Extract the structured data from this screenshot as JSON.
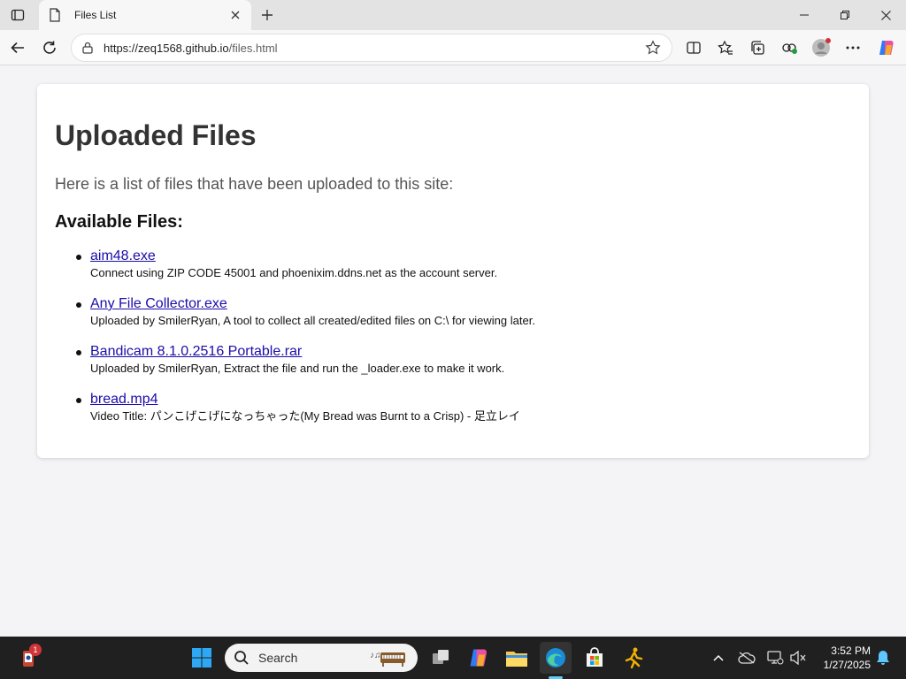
{
  "browser": {
    "tab_title": "Files List",
    "url_host": "https://zeq1568.github.io",
    "url_path": "/files.html",
    "icons": [
      "tab-actions-icon",
      "page-icon",
      "close-icon",
      "plus-icon",
      "minimize-icon",
      "restore-icon",
      "window-close-icon",
      "back-icon",
      "refresh-icon",
      "site-info-icon",
      "favorite-star-icon",
      "split-screen-icon",
      "favorites-icon",
      "collections-icon",
      "extensions-icon",
      "profile-icon",
      "more-icon",
      "copilot-icon"
    ]
  },
  "page": {
    "title": "Uploaded Files",
    "intro": "Here is a list of files that have been uploaded to this site:",
    "section_heading": "Available Files:",
    "files": [
      {
        "name": "aim48.exe",
        "desc": "Connect using ZIP CODE 45001 and phoenixim.ddns.net as the account server."
      },
      {
        "name": "Any File Collector.exe",
        "desc": "Uploaded by SmilerRyan, A tool to collect all created/edited files on C:\\ for viewing later."
      },
      {
        "name": "Bandicam 8.1.0.2516 Portable.rar",
        "desc": "Uploaded by SmilerRyan, Extract the file and run the _loader.exe to make it work."
      },
      {
        "name": "bread.mp4",
        "desc": "Video Title: パンこげこげになっちゃった(My Bread was Burnt to a Crisp) - 足立レイ"
      }
    ],
    "link_color": "#1a0dab"
  },
  "taskbar": {
    "search_placeholder": "Search",
    "notification_count": "1",
    "time": "3:52 PM",
    "date": "1/27/2025",
    "accent": "#60cdff"
  }
}
